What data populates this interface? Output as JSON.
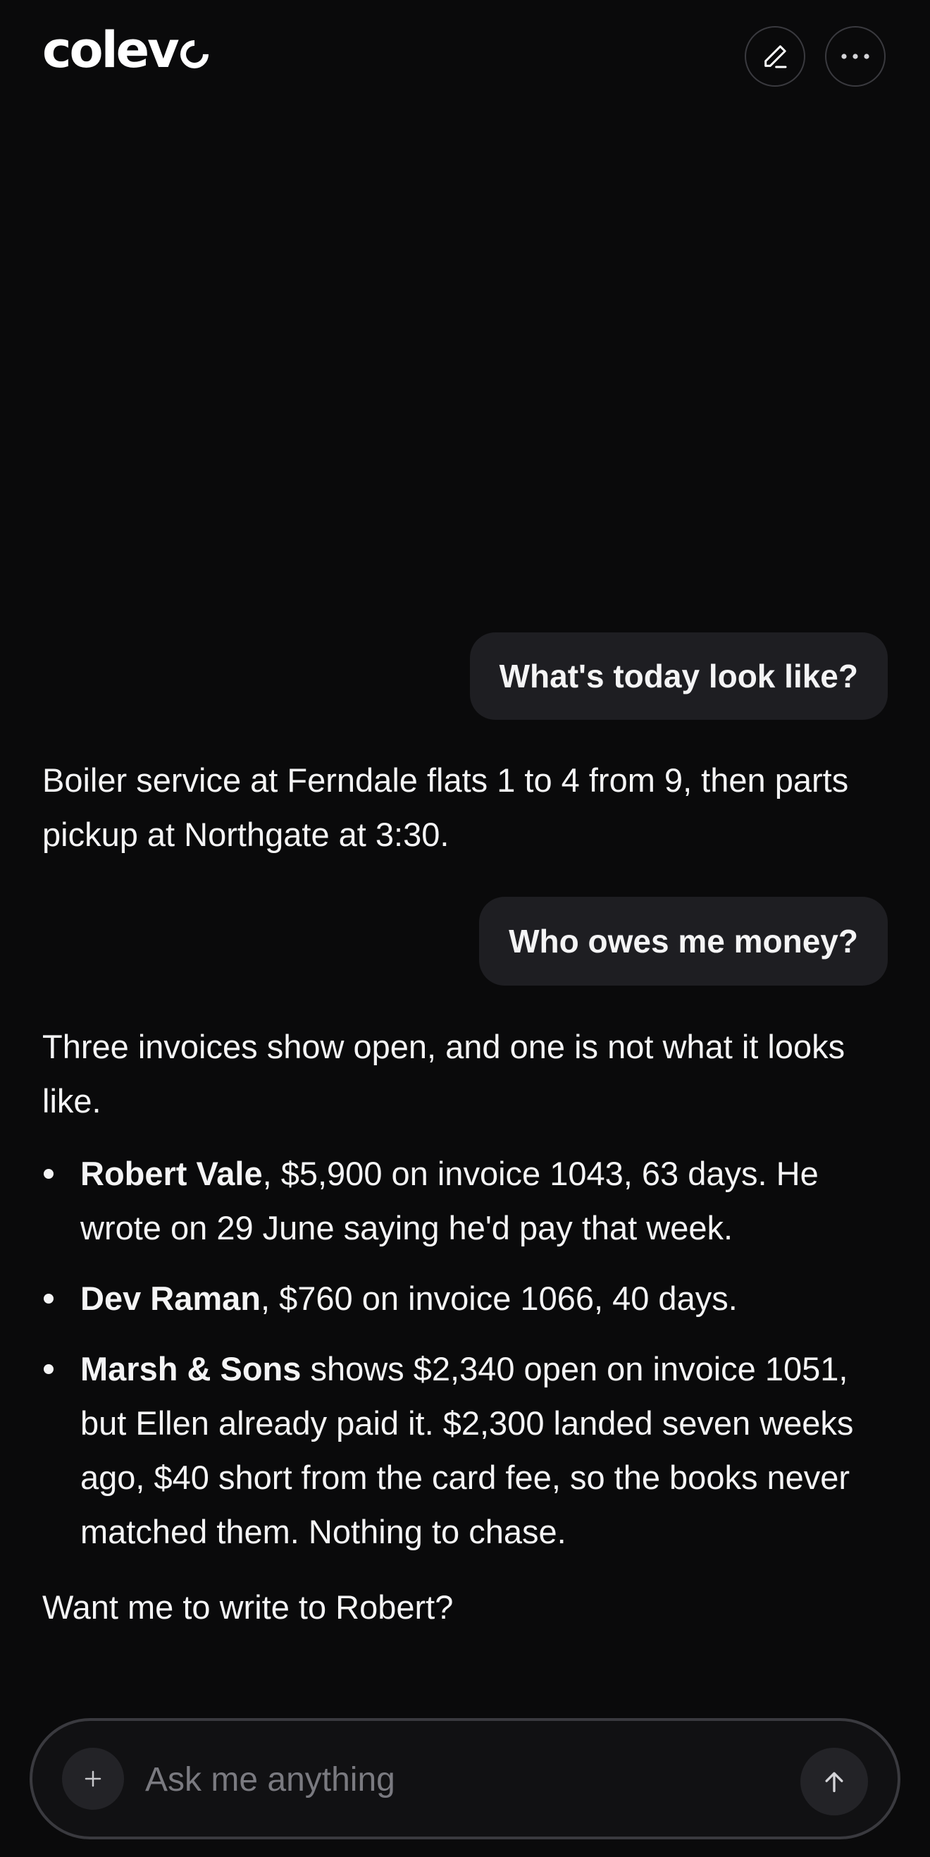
{
  "app": {
    "brand": "colev"
  },
  "header": {
    "edit_icon": "pencil-icon",
    "more_icon": "ellipsis-icon"
  },
  "conversation": {
    "messages": [
      {
        "role": "user",
        "text": "What's today look like?"
      },
      {
        "role": "assistant",
        "text": "Boiler service at Ferndale flats 1 to 4 from 9, then parts pickup at Northgate at 3:30."
      },
      {
        "role": "user",
        "text": "Who owes me money?"
      },
      {
        "role": "assistant",
        "intro": "Three invoices show open, and one is not what it looks like.",
        "items": [
          {
            "name": "Robert Vale",
            "detail": ", $5,900 on invoice 1043, 63 days. He wrote on 29 June saying he'd pay that week."
          },
          {
            "name": "Dev Raman",
            "detail": ", $760 on invoice 1066, 40 days."
          },
          {
            "name": "Marsh & Sons",
            "detail": " shows $2,340 open on invoice 1051, but Ellen already paid it. $2,300 landed seven weeks ago, $40 short from the card fee, so the books never matched them. Nothing to chase."
          }
        ],
        "closing": "Want me to write to Robert?"
      }
    ]
  },
  "composer": {
    "placeholder": "Ask me anything",
    "value": "",
    "add_icon": "plus-icon",
    "send_icon": "arrow-up-icon"
  },
  "colors": {
    "background": "#0a0a0b",
    "user_bubble": "#1e1e22",
    "border": "#3a3a3f",
    "placeholder": "#7a7a80"
  }
}
